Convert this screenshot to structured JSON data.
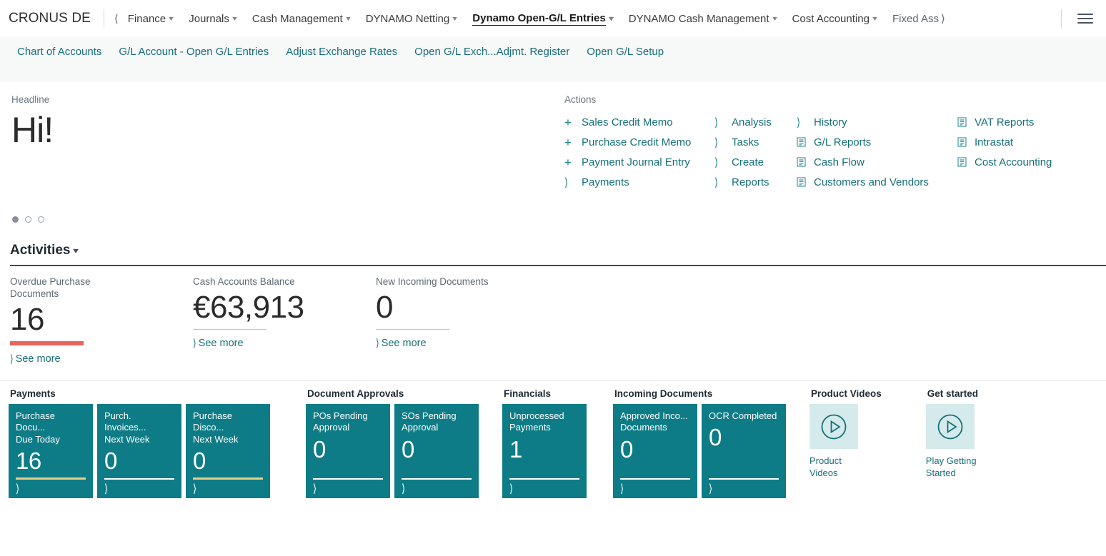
{
  "topnav": {
    "company": "CRONUS DE",
    "back_icon": "chevron-left-icon",
    "forward_icon": "chevron-right-icon",
    "forward_label": "Fixed Ass",
    "menu_icon": "hamburger-icon",
    "items": [
      {
        "label": "Finance",
        "chev": "⌄",
        "active": false
      },
      {
        "label": "Journals",
        "chev": "⌄",
        "active": false
      },
      {
        "label": "Cash Management",
        "chev": "⌄",
        "active": false
      },
      {
        "label": "DYNAMO Netting",
        "chev": "⌄",
        "active": false
      },
      {
        "label": "Dynamo Open-G/L Entries",
        "chev": "⌄",
        "active": true
      },
      {
        "label": "DYNAMO Cash Management",
        "chev": "⌄",
        "active": false
      },
      {
        "label": "Cost Accounting",
        "chev": "⌄",
        "active": false
      }
    ]
  },
  "subnav": {
    "links": [
      "Chart of Accounts",
      "G/L Account - Open G/L Entries",
      "Adjust Exchange Rates",
      "Open G/L Exch...Adjmt. Register",
      "Open G/L Setup"
    ]
  },
  "headline": {
    "label": "Headline",
    "text": "Hi!",
    "carousel": {
      "total": 3,
      "active_index": 0
    }
  },
  "actions": {
    "label": "Actions",
    "columns": [
      {
        "items": [
          {
            "label": "Sales Credit Memo",
            "icon": "plus-icon"
          },
          {
            "label": "Purchase Credit Memo",
            "icon": "plus-icon"
          },
          {
            "label": "Payment Journal Entry",
            "icon": "plus-icon"
          },
          {
            "label": "Payments",
            "icon": "chevron-right-icon"
          }
        ]
      },
      {
        "items": [
          {
            "label": "Analysis",
            "icon": "chevron-right-icon"
          },
          {
            "label": "Tasks",
            "icon": "chevron-right-icon"
          },
          {
            "label": "Create",
            "icon": "chevron-right-icon"
          },
          {
            "label": "Reports",
            "icon": "chevron-right-icon"
          }
        ]
      },
      {
        "items": [
          {
            "label": "History",
            "icon": "chevron-right-icon"
          },
          {
            "label": "G/L Reports",
            "icon": "report-icon"
          },
          {
            "label": "Cash Flow",
            "icon": "report-icon"
          },
          {
            "label": "Customers and Vendors",
            "icon": "report-icon"
          }
        ]
      },
      {
        "items": [
          {
            "label": "VAT Reports",
            "icon": "report-icon"
          },
          {
            "label": "Intrastat",
            "icon": "report-icon"
          },
          {
            "label": "Cost Accounting",
            "icon": "report-icon"
          }
        ]
      }
    ]
  },
  "activities": {
    "title": "Activities",
    "chev": "⌄",
    "cues": [
      {
        "title": "Overdue Purchase Documents",
        "value": "16",
        "bar_color": "#E8645E",
        "bar_style": "thick",
        "see_more": "See more"
      },
      {
        "title": "Cash Accounts Balance",
        "value": "€63,913",
        "bar_color": "#BFC5CB",
        "bar_style": "thin",
        "see_more": "See more"
      },
      {
        "title": "New Incoming Documents",
        "value": "0",
        "bar_color": "#BFC5CB",
        "bar_style": "thin",
        "see_more": "See more"
      }
    ]
  },
  "groups": [
    {
      "title": "Payments",
      "tiles": [
        {
          "caption": "Purchase Docu...\nDue Today",
          "line1": "Purchase Docu...",
          "line2": "Due Today",
          "value": "16",
          "bar": "khaki"
        },
        {
          "caption": "Purch. Invoices...\nNext Week",
          "line1": "Purch. Invoices...",
          "line2": "Next Week",
          "value": "0",
          "bar": "white"
        },
        {
          "caption": "Purchase Disco...\nNext Week",
          "line1": "Purchase Disco...",
          "line2": "Next Week",
          "value": "0",
          "bar": "khaki"
        }
      ]
    },
    {
      "title": "Document Approvals",
      "tiles": [
        {
          "line1": "POs Pending",
          "line2": "Approval",
          "value": "0",
          "bar": "white"
        },
        {
          "line1": "SOs Pending",
          "line2": "Approval",
          "value": "0",
          "bar": "white"
        }
      ]
    },
    {
      "title": "Financials",
      "tiles": [
        {
          "line1": "Unprocessed",
          "line2": "Payments",
          "value": "1",
          "bar": "white"
        }
      ]
    },
    {
      "title": "Incoming Documents",
      "tiles": [
        {
          "line1": "Approved Inco...",
          "line2": "Documents",
          "value": "0",
          "bar": "white"
        },
        {
          "line1": "OCR Completed",
          "line2": "",
          "value": "0",
          "bar": "white"
        }
      ]
    }
  ],
  "videos": [
    {
      "group_title": "Product Videos",
      "caption": "Product Videos",
      "icon": "play-circle-icon"
    },
    {
      "group_title": "Get started",
      "caption": "Play Getting Started",
      "icon": "play-circle-icon"
    }
  ],
  "colors": {
    "teal_tile": "#0E7C86",
    "link_teal": "#166F78",
    "overdue_red": "#E8645E",
    "tile_bar_khaki": "#E5D08B",
    "video_bg": "#D5EAEA",
    "subnav_bg": "#F7F8F8",
    "rule_dark": "#3D4C5A"
  }
}
